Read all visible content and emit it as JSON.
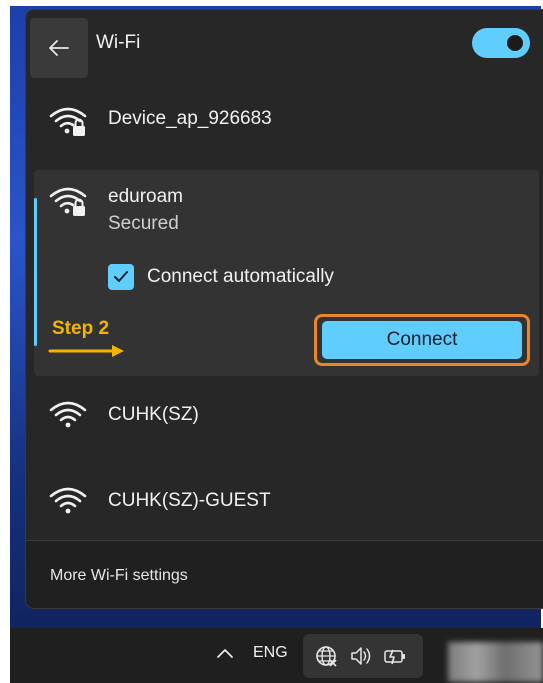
{
  "header": {
    "title": "Wi-Fi",
    "back_icon": "arrow-left-icon",
    "toggle_state": "on",
    "toggle_color": "#60cdff"
  },
  "networks": [
    {
      "name": "Device_ap_926683",
      "secured": true,
      "icon": "wifi-lock-icon"
    },
    {
      "name": "eduroam",
      "status": "Secured",
      "secured": true,
      "icon": "wifi-lock-icon",
      "expanded": true,
      "auto_connect_label": "Connect automatically",
      "auto_connect_checked": true,
      "connect_label": "Connect"
    },
    {
      "name": "CUHK(SZ)",
      "secured": false,
      "icon": "wifi-icon"
    },
    {
      "name": "CUHK(SZ)-GUEST",
      "secured": false,
      "icon": "wifi-icon"
    }
  ],
  "annotation": {
    "step_label": "Step 2",
    "color": "#f4b400",
    "highlight_color": "#e8872a"
  },
  "footer": {
    "more_settings_label": "More Wi-Fi settings"
  },
  "taskbar": {
    "language": "ENG",
    "icons": [
      "chevron-up-icon",
      "network-globe-icon",
      "volume-icon",
      "battery-icon"
    ]
  }
}
